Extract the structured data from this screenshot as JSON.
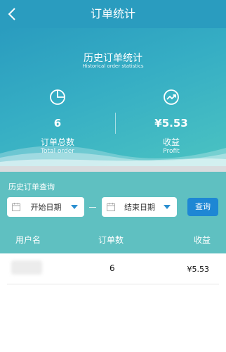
{
  "header": {
    "title": "订单统计"
  },
  "hero": {
    "title": "历史订单统计",
    "subtitle": "Historical order statistics",
    "total_orders": {
      "value": "6",
      "label": "订单总数",
      "label_en": "Total order",
      "icon": "pie-chart-icon"
    },
    "profit": {
      "value": "¥5.53",
      "label": "收益",
      "label_en": "Profit",
      "icon": "trend-up-icon"
    }
  },
  "query": {
    "title": "历史订单查询",
    "start_date_placeholder": "开始日期",
    "end_date_placeholder": "结束日期",
    "button": "查询"
  },
  "table": {
    "headers": [
      "用户名",
      "订单数",
      "收益"
    ],
    "rows": [
      {
        "user": "",
        "orders": "6",
        "profit": "¥5.53"
      }
    ]
  },
  "colors": {
    "primary": "#2a9cbf",
    "teal": "#5fc0c1",
    "button": "#1e87d4"
  }
}
